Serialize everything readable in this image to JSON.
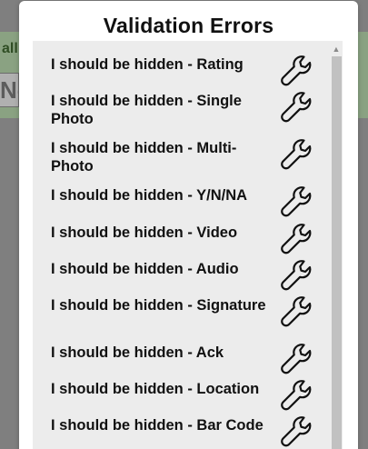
{
  "background": {
    "tab_label": "all",
    "input_value": "No"
  },
  "dialog": {
    "title": "Validation Errors",
    "errors": [
      {
        "text": "I should be hidden - Rating",
        "icon": "wrench-icon"
      },
      {
        "text": "I should be hidden - Single Photo",
        "icon": "wrench-icon"
      },
      {
        "text": "I should be hidden - Multi-Photo",
        "icon": "wrench-icon"
      },
      {
        "text": "I should be hidden - Y/N/NA",
        "icon": "wrench-icon"
      },
      {
        "text": "I should be hidden - Video",
        "icon": "wrench-icon"
      },
      {
        "text": "I should be hidden - Audio",
        "icon": "wrench-icon"
      },
      {
        "text": "I should be hidden - Signature",
        "icon": "wrench-icon"
      },
      {
        "text": "I should be hidden - Ack",
        "icon": "wrench-icon"
      },
      {
        "text": "I should be hidden - Location",
        "icon": "wrench-icon"
      },
      {
        "text": "I should be hidden - Bar Code",
        "icon": "wrench-icon"
      }
    ]
  }
}
